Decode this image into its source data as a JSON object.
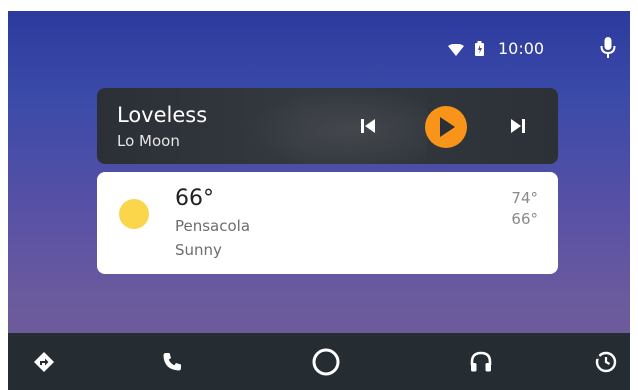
{
  "status_bar": {
    "time": "10:00",
    "icons": [
      "wifi-icon",
      "battery-icon",
      "microphone-icon"
    ]
  },
  "media": {
    "title": "Loveless",
    "artist": "Lo Moon",
    "controls": [
      "skip-previous-icon",
      "play-icon",
      "skip-next-icon"
    ]
  },
  "weather": {
    "temperature": "66°",
    "city": "Pensacola",
    "condition": "Sunny",
    "high": "74°",
    "low": "66°",
    "icon": "sun-icon"
  },
  "nav_bar": {
    "items": [
      "navigation-icon",
      "phone-icon",
      "home-icon",
      "headphones-icon",
      "overview-icon"
    ]
  },
  "colors": {
    "accent": "#f79419",
    "sun": "#fbd54a",
    "nav_bg": "#252d33",
    "media_card_bg": "#2f343b",
    "gradient_top": "#2d3a9e",
    "gradient_bottom": "#6f5c96"
  }
}
